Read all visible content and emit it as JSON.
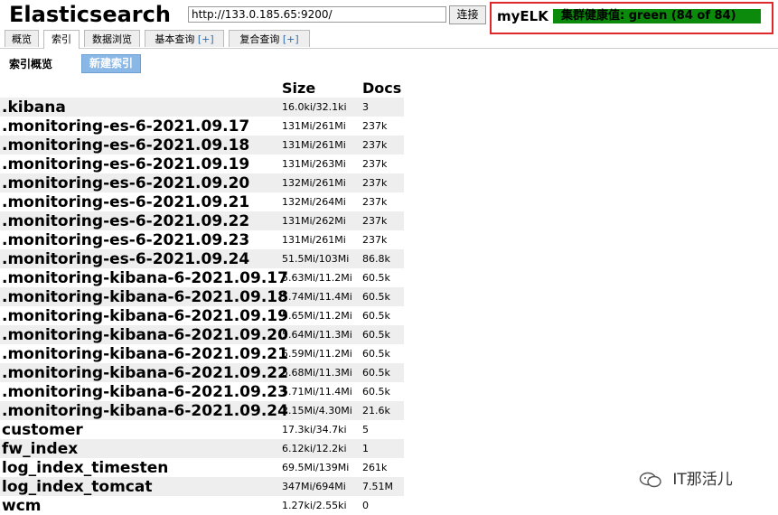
{
  "header": {
    "app_title": "Elasticsearch",
    "url_value": "http://133.0.185.65:9200/",
    "connect_label": "连接",
    "cluster_name": "myELK",
    "health_text": "集群健康值: green (84 of 84)"
  },
  "tabs": [
    {
      "label": "概览",
      "plus": ""
    },
    {
      "label": "索引",
      "plus": ""
    },
    {
      "label": "数据浏览",
      "plus": ""
    },
    {
      "label": "基本查询",
      "plus": "[+]"
    },
    {
      "label": "复合查询",
      "plus": "[+]"
    }
  ],
  "subbar": {
    "label": "索引概览",
    "new_index_label": "新建索引"
  },
  "table": {
    "size_header": "Size",
    "docs_header": "Docs",
    "rows": [
      {
        "name": ".kibana",
        "size": "16.0ki/32.1ki",
        "docs": "3"
      },
      {
        "name": ".monitoring-es-6-2021.09.17",
        "size": "131Mi/261Mi",
        "docs": "237k"
      },
      {
        "name": ".monitoring-es-6-2021.09.18",
        "size": "131Mi/261Mi",
        "docs": "237k"
      },
      {
        "name": ".monitoring-es-6-2021.09.19",
        "size": "131Mi/263Mi",
        "docs": "237k"
      },
      {
        "name": ".monitoring-es-6-2021.09.20",
        "size": "132Mi/261Mi",
        "docs": "237k"
      },
      {
        "name": ".monitoring-es-6-2021.09.21",
        "size": "132Mi/264Mi",
        "docs": "237k"
      },
      {
        "name": ".monitoring-es-6-2021.09.22",
        "size": "131Mi/262Mi",
        "docs": "237k"
      },
      {
        "name": ".monitoring-es-6-2021.09.23",
        "size": "131Mi/261Mi",
        "docs": "237k"
      },
      {
        "name": ".monitoring-es-6-2021.09.24",
        "size": "51.5Mi/103Mi",
        "docs": "86.8k"
      },
      {
        "name": ".monitoring-kibana-6-2021.09.17",
        "size": "5.63Mi/11.2Mi",
        "docs": "60.5k"
      },
      {
        "name": ".monitoring-kibana-6-2021.09.18",
        "size": "5.74Mi/11.4Mi",
        "docs": "60.5k"
      },
      {
        "name": ".monitoring-kibana-6-2021.09.19",
        "size": "5.65Mi/11.2Mi",
        "docs": "60.5k"
      },
      {
        "name": ".monitoring-kibana-6-2021.09.20",
        "size": "5.64Mi/11.3Mi",
        "docs": "60.5k"
      },
      {
        "name": ".monitoring-kibana-6-2021.09.21",
        "size": "5.59Mi/11.2Mi",
        "docs": "60.5k"
      },
      {
        "name": ".monitoring-kibana-6-2021.09.22",
        "size": "5.68Mi/11.3Mi",
        "docs": "60.5k"
      },
      {
        "name": ".monitoring-kibana-6-2021.09.23",
        "size": "5.71Mi/11.4Mi",
        "docs": "60.5k"
      },
      {
        "name": ".monitoring-kibana-6-2021.09.24",
        "size": "2.15Mi/4.30Mi",
        "docs": "21.6k"
      },
      {
        "name": "customer",
        "size": "17.3ki/34.7ki",
        "docs": "5"
      },
      {
        "name": "fw_index",
        "size": "6.12ki/12.2ki",
        "docs": "1"
      },
      {
        "name": "log_index_timesten",
        "size": "69.5Mi/139Mi",
        "docs": "261k"
      },
      {
        "name": "log_index_tomcat",
        "size": "347Mi/694Mi",
        "docs": "7.51M"
      },
      {
        "name": "wcm",
        "size": "1.27ki/2.55ki",
        "docs": "0"
      }
    ]
  },
  "watermark": {
    "text": "IT那活儿",
    "icon": "wechat-icon"
  },
  "colors": {
    "health_green": "#0b8a0b",
    "highlight_border": "#e0272a",
    "new_index_blue": "#8ab8e6"
  }
}
